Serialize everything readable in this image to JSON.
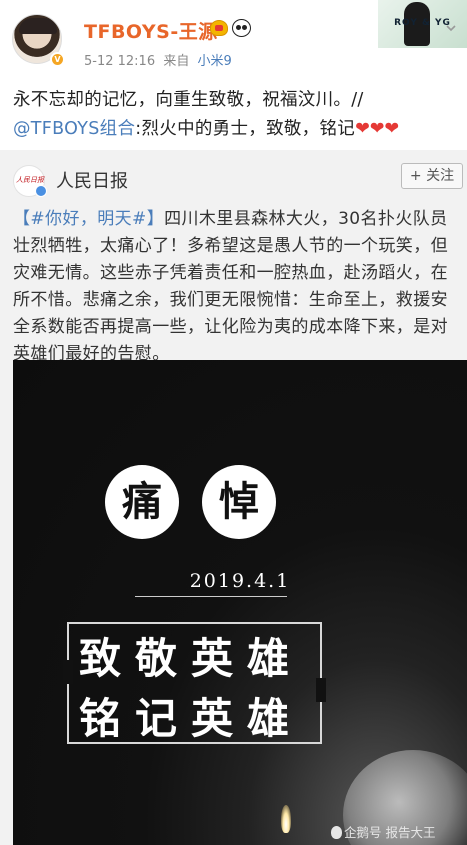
{
  "header": {
    "username": "TFBOYS-王源",
    "timestamp": "5-12 12:16",
    "source_prefix": "来自",
    "source_device": "小米9",
    "verified_icon": "v-badge-icon",
    "badges": [
      "crown-icon",
      "panda-icon"
    ],
    "decoration_text": "ROY & YG"
  },
  "post": {
    "line1": "永不忘却的记忆，向重生致敬，祝福汶川。//",
    "mention": "@TFBOYS组合",
    "line2_rest": ":烈火中的勇士，致敬，铭记",
    "hearts": "❤❤❤"
  },
  "repost": {
    "author": "人民日报",
    "logo_text": "人民日报",
    "follow_label": "+ 关注",
    "hashtag": "【#你好，明天#】",
    "text": "四川木里县森林大火，30名扑火队员壮烈牺牲，太痛心了！多希望这是愚人节的一个玩笑，但灾难无情。这些赤子凭着责任和一腔热血，赴汤蹈火，在所不惜。悲痛之余，我们更无限惋惜：生命至上，救援安全系数能否再提高一些，让化险为夷的成本降下来，是对英雄们最好的告慰。"
  },
  "image": {
    "circle1": "痛",
    "circle2": "悼",
    "date": "2019.4.1",
    "line1": "致敬英雄",
    "line2": "铭记英雄",
    "watermark": "企鹅号 报告大王"
  },
  "colors": {
    "username": "#e8662a",
    "link": "#4a7dba",
    "heart": "#e53935",
    "repost_bg": "#f2f2f2",
    "image_bg": "#111111"
  }
}
